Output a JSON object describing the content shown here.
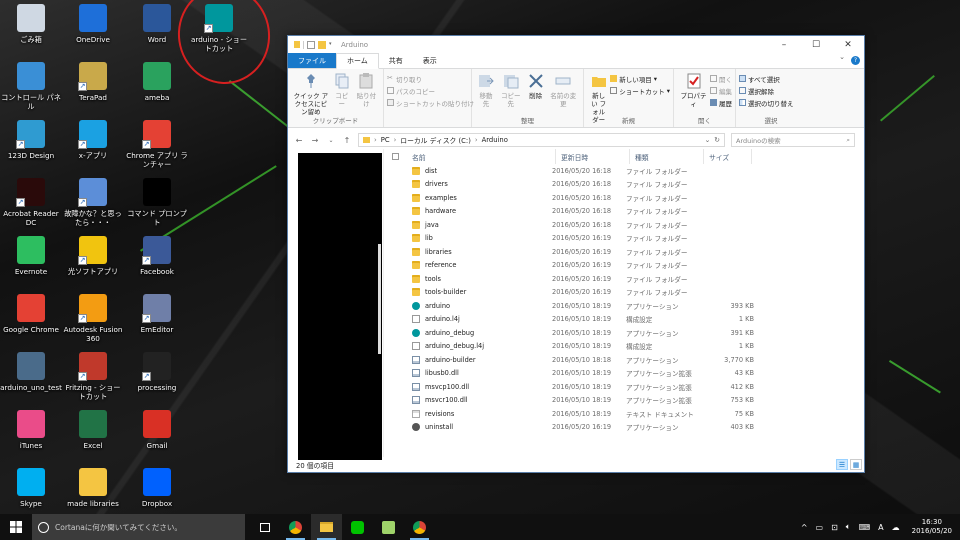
{
  "desktop": {
    "icons": [
      {
        "label": "ごみ箱",
        "icon": "recycle-bin-icon",
        "color": "#cfd8e3"
      },
      {
        "label": "OneDrive",
        "icon": "onedrive-icon",
        "color": "#1e6fd9"
      },
      {
        "label": "Word",
        "icon": "word-icon",
        "color": "#2b579a"
      },
      {
        "label": "arduino - ショートカット",
        "icon": "arduino-icon",
        "color": "#00979d"
      },
      {
        "label": "コントロール パネル",
        "icon": "control-panel-icon",
        "color": "#3a8fd6"
      },
      {
        "label": "TeraPad",
        "icon": "terapad-icon",
        "color": "#c9a94a"
      },
      {
        "label": "ameba",
        "icon": "ameba-icon",
        "color": "#2aa25e"
      },
      {
        "label": "123D Design",
        "icon": "123d-design-icon",
        "color": "#2f9bd1"
      },
      {
        "label": "x-アプリ",
        "icon": "x-app-icon",
        "color": "#1ba1e2"
      },
      {
        "label": "Chrome アプリ ランチャー",
        "icon": "chrome-app-launcher-icon",
        "color": "#e44134"
      },
      {
        "label": "Acrobat Reader DC",
        "icon": "acrobat-reader-icon",
        "color": "#2a0a0a"
      },
      {
        "label": "故障かな？と思ったら・・・",
        "icon": "troubleshoot-icon",
        "color": "#5c8ed8"
      },
      {
        "label": "コマンド プロンプト",
        "icon": "command-prompt-icon",
        "color": "#000000"
      },
      {
        "label": "Evernote",
        "icon": "evernote-icon",
        "color": "#2dbe60"
      },
      {
        "label": "光ソフトアプリ",
        "icon": "hikari-soft-icon",
        "color": "#f1c40f"
      },
      {
        "label": "Facebook",
        "icon": "facebook-icon",
        "color": "#3b5998"
      },
      {
        "label": "Google Chrome",
        "icon": "chrome-icon",
        "color": "#e44134"
      },
      {
        "label": "Autodesk Fusion 360",
        "icon": "fusion-360-icon",
        "color": "#f39c12"
      },
      {
        "label": "EmEditor",
        "icon": "emeditor-icon",
        "color": "#6f7fa8"
      },
      {
        "label": "arduino_uno_test",
        "icon": "arduino-uno-test-icon",
        "color": "#4a6b8a"
      },
      {
        "label": "Fritzing - ショートカット",
        "icon": "fritzing-icon",
        "color": "#c0392b"
      },
      {
        "label": "processing",
        "icon": "processing-icon",
        "color": "#222222"
      },
      {
        "label": "iTunes",
        "icon": "itunes-icon",
        "color": "#ea4c89"
      },
      {
        "label": "Excel",
        "icon": "excel-icon",
        "color": "#217346"
      },
      {
        "label": "Gmail",
        "icon": "gmail-icon",
        "color": "#d93025"
      },
      {
        "label": "Skype",
        "icon": "skype-icon",
        "color": "#00aff0"
      },
      {
        "label": "made libraries",
        "icon": "folder-icon",
        "color": "#f4c542"
      },
      {
        "label": "Dropbox",
        "icon": "dropbox-icon",
        "color": "#0061fe"
      }
    ]
  },
  "explorer": {
    "title": "Arduino",
    "tabs": {
      "file": "ファイル",
      "home": "ホーム",
      "share": "共有",
      "view": "表示"
    },
    "ribbon": {
      "pin": "クイック アクセスにピン留め",
      "copy": "コピー",
      "paste": "貼り付け",
      "cut": "切り取り",
      "copy_path": "パスのコピー",
      "paste_shortcut": "ショートカットの貼り付け",
      "clipboard_group": "クリップボード",
      "move_to": "移動先",
      "copy_to": "コピー先",
      "delete": "削除",
      "rename": "名前の変更",
      "organize_group": "整理",
      "new_folder": "新しい フォルダー",
      "new_item": "新しい項目",
      "shortcut": "ショートカット",
      "new_group": "新規",
      "properties": "プロパティ",
      "open": "開く",
      "edit": "編集",
      "history": "履歴",
      "open_group": "開く",
      "select_all": "すべて選択",
      "select_none": "選択解除",
      "invert_selection": "選択の切り替え",
      "select_group": "選択"
    },
    "address": {
      "pc": "PC",
      "drive": "ローカル ディスク (C:)",
      "folder": "Arduino"
    },
    "search_placeholder": "Arduinoの検索",
    "columns": {
      "name": "名前",
      "date": "更新日時",
      "type": "種類",
      "size": "サイズ"
    },
    "files": [
      {
        "name": "dist",
        "date": "2016/05/20 16:18",
        "type": "ファイル フォルダー",
        "size": "",
        "kind": "folder"
      },
      {
        "name": "drivers",
        "date": "2016/05/20 16:18",
        "type": "ファイル フォルダー",
        "size": "",
        "kind": "folder"
      },
      {
        "name": "examples",
        "date": "2016/05/20 16:18",
        "type": "ファイル フォルダー",
        "size": "",
        "kind": "folder"
      },
      {
        "name": "hardware",
        "date": "2016/05/20 16:18",
        "type": "ファイル フォルダー",
        "size": "",
        "kind": "folder"
      },
      {
        "name": "java",
        "date": "2016/05/20 16:18",
        "type": "ファイル フォルダー",
        "size": "",
        "kind": "folder"
      },
      {
        "name": "lib",
        "date": "2016/05/20 16:19",
        "type": "ファイル フォルダー",
        "size": "",
        "kind": "folder"
      },
      {
        "name": "libraries",
        "date": "2016/05/20 16:19",
        "type": "ファイル フォルダー",
        "size": "",
        "kind": "folder"
      },
      {
        "name": "reference",
        "date": "2016/05/20 16:19",
        "type": "ファイル フォルダー",
        "size": "",
        "kind": "folder"
      },
      {
        "name": "tools",
        "date": "2016/05/20 16:19",
        "type": "ファイル フォルダー",
        "size": "",
        "kind": "folder"
      },
      {
        "name": "tools-builder",
        "date": "2016/05/20 16:19",
        "type": "ファイル フォルダー",
        "size": "",
        "kind": "folder"
      },
      {
        "name": "arduino",
        "date": "2016/05/10 18:19",
        "type": "アプリケーション",
        "size": "393 KB",
        "kind": "app"
      },
      {
        "name": "arduino.l4j",
        "date": "2016/05/10 18:19",
        "type": "構成設定",
        "size": "1 KB",
        "kind": "ini"
      },
      {
        "name": "arduino_debug",
        "date": "2016/05/10 18:19",
        "type": "アプリケーション",
        "size": "391 KB",
        "kind": "app"
      },
      {
        "name": "arduino_debug.l4j",
        "date": "2016/05/10 18:19",
        "type": "構成設定",
        "size": "1 KB",
        "kind": "ini"
      },
      {
        "name": "arduino-builder",
        "date": "2016/05/10 18:18",
        "type": "アプリケーション",
        "size": "3,770 KB",
        "kind": "dll"
      },
      {
        "name": "libusb0.dll",
        "date": "2016/05/10 18:19",
        "type": "アプリケーション拡張",
        "size": "43 KB",
        "kind": "dll"
      },
      {
        "name": "msvcp100.dll",
        "date": "2016/05/10 18:19",
        "type": "アプリケーション拡張",
        "size": "412 KB",
        "kind": "dll"
      },
      {
        "name": "msvcr100.dll",
        "date": "2016/05/10 18:19",
        "type": "アプリケーション拡張",
        "size": "753 KB",
        "kind": "dll"
      },
      {
        "name": "revisions",
        "date": "2016/05/10 18:19",
        "type": "テキスト ドキュメント",
        "size": "75 KB",
        "kind": "txt"
      },
      {
        "name": "uninstall",
        "date": "2016/05/20 16:19",
        "type": "アプリケーション",
        "size": "403 KB",
        "kind": "uninst"
      }
    ],
    "status": "20 個の項目"
  },
  "taskbar": {
    "cortana_placeholder": "Cortanaに何か聞いてみてください。",
    "apps": [
      "task-view-icon",
      "chrome-icon",
      "file-explorer-icon",
      "line-icon",
      "fritzing-icon",
      "chrome-icon"
    ],
    "ime": "A",
    "time": "16:30",
    "date": "2016/05/20"
  }
}
